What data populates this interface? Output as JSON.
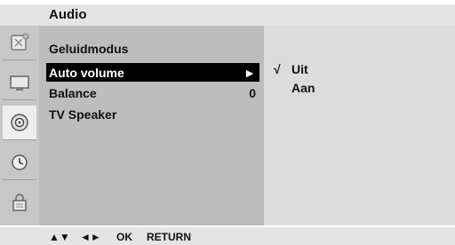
{
  "header": {
    "title": "Audio"
  },
  "sidebar": {
    "icons": [
      {
        "name": "picture-icon"
      },
      {
        "name": "screen-icon"
      },
      {
        "name": "audio-icon",
        "selected": true
      },
      {
        "name": "clock-icon"
      },
      {
        "name": "lock-icon"
      }
    ]
  },
  "menu": {
    "items": [
      {
        "label": "Geluidmodus",
        "value": ""
      },
      {
        "label": "Auto volume",
        "value": "►",
        "active": true
      },
      {
        "label": "Balance",
        "value": "0"
      },
      {
        "label": "TV Speaker",
        "value": ""
      }
    ]
  },
  "submenu": {
    "options": [
      {
        "label": "Uit",
        "check": "√"
      },
      {
        "label": "Aan",
        "check": ""
      }
    ]
  },
  "footer": {
    "nav_updown": "▲▼",
    "nav_leftright": "◄►",
    "ok": "OK",
    "return": "RETURN"
  }
}
